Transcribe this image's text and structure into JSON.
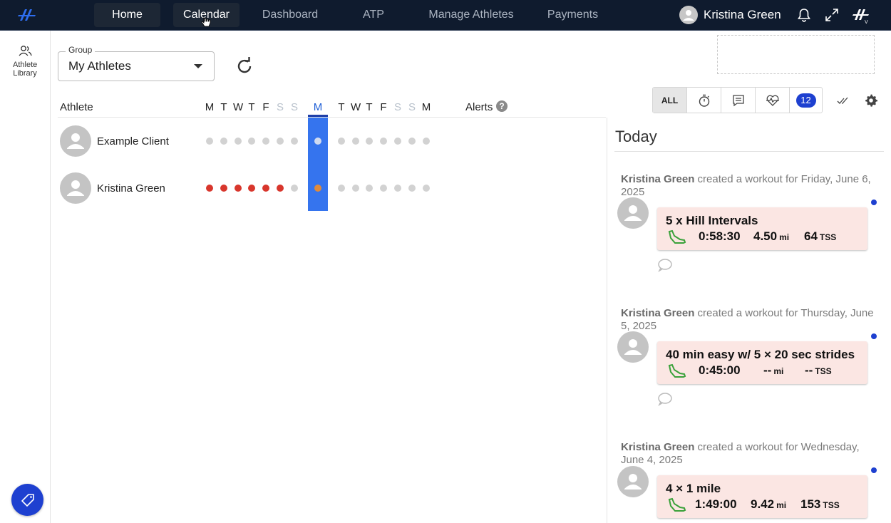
{
  "nav": {
    "tabs": [
      {
        "label": "Home"
      },
      {
        "label": "Calendar"
      },
      {
        "label": "Dashboard"
      },
      {
        "label": "ATP"
      },
      {
        "label": "Manage Athletes"
      },
      {
        "label": "Payments"
      }
    ],
    "user_name": "Kristina Green",
    "icons": [
      "bell-icon",
      "expand-icon",
      "brand-logo-icon"
    ]
  },
  "rail": {
    "athlete_library": "Athlete Library"
  },
  "group": {
    "legend": "Group",
    "value": "My Athletes"
  },
  "table": {
    "athlete_header": "Athlete",
    "days": [
      "M",
      "T",
      "W",
      "T",
      "F",
      "S",
      "S",
      "M",
      "T",
      "W",
      "T",
      "F",
      "S",
      "S",
      "M"
    ],
    "alerts_header": "Alerts",
    "help": "?",
    "rows": [
      {
        "name": "Example Client",
        "dots": [
          "grey",
          "grey",
          "grey",
          "grey",
          "grey",
          "grey",
          "grey",
          "today-empty",
          "grey",
          "grey",
          "grey",
          "grey",
          "grey",
          "grey",
          "grey"
        ]
      },
      {
        "name": "Kristina Green",
        "dots": [
          "red",
          "red",
          "red",
          "red",
          "red",
          "red",
          "grey",
          "today-orange",
          "grey",
          "grey",
          "grey",
          "grey",
          "grey",
          "grey",
          "grey"
        ]
      }
    ]
  },
  "filters": {
    "all_label": "ALL",
    "badge_count": "12",
    "icons": [
      "stopwatch-icon",
      "comment-icon",
      "heart-rate-icon"
    ]
  },
  "panel": {
    "title": "Today",
    "feed": [
      {
        "actor": "Kristina Green",
        "text": " created a workout for Friday, June 6, 2025",
        "workout_title": "5 x Hill Intervals",
        "duration": "0:58:30",
        "distance": "4.50",
        "distance_unit": "mi",
        "tss": "64",
        "tss_unit": "TSS"
      },
      {
        "actor": "Kristina Green",
        "text": " created a workout for Thursday, June 5, 2025",
        "workout_title": "40 min easy w/ 5 × 20 sec strides",
        "duration": "0:45:00",
        "distance": "--",
        "distance_unit": "mi",
        "tss": "--",
        "tss_unit": "TSS"
      },
      {
        "actor": "Kristina Green",
        "text": " created a workout for Wednesday, June 4, 2025",
        "workout_title": "4 × 1 mile",
        "duration": "1:49:00",
        "distance": "9.42",
        "distance_unit": "mi",
        "tss": "153",
        "tss_unit": "TSS"
      }
    ]
  },
  "colors": {
    "nav_bg": "#0f1b2e",
    "accent": "#1e40d0",
    "today_column": "#3574ee",
    "completed_dot": "#d8362c",
    "card_bg": "#fbe6e3"
  }
}
